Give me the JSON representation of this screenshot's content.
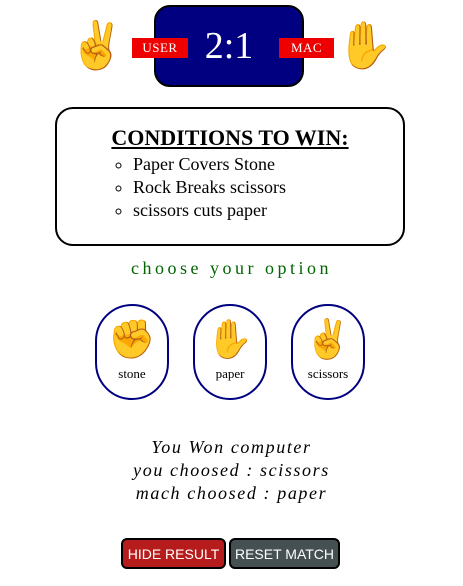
{
  "scoreboard": {
    "score": "2:1",
    "user_label": "USER",
    "mac_label": "MAC",
    "user_hand": "✌️",
    "mac_hand": "✋",
    "bg_color": "#000080",
    "tag_color": "#ee0000"
  },
  "conditions": {
    "title": "CONDITIONS TO WIN:",
    "rules": [
      "Paper Covers Stone",
      "Rock Breaks scissors",
      "scissors cuts paper"
    ]
  },
  "prompt": "choose your option",
  "options": [
    {
      "emoji": "✊",
      "label": "stone"
    },
    {
      "emoji": "✋",
      "label": "paper"
    },
    {
      "emoji": "✌️",
      "label": "scissors"
    }
  ],
  "result": {
    "line1": "You Won computer",
    "line2": "you choosed : scissors",
    "line3": "mach choosed : paper"
  },
  "buttons": {
    "hide_result": "HIDE RESULT",
    "reset_match": "RESET MATCH"
  }
}
